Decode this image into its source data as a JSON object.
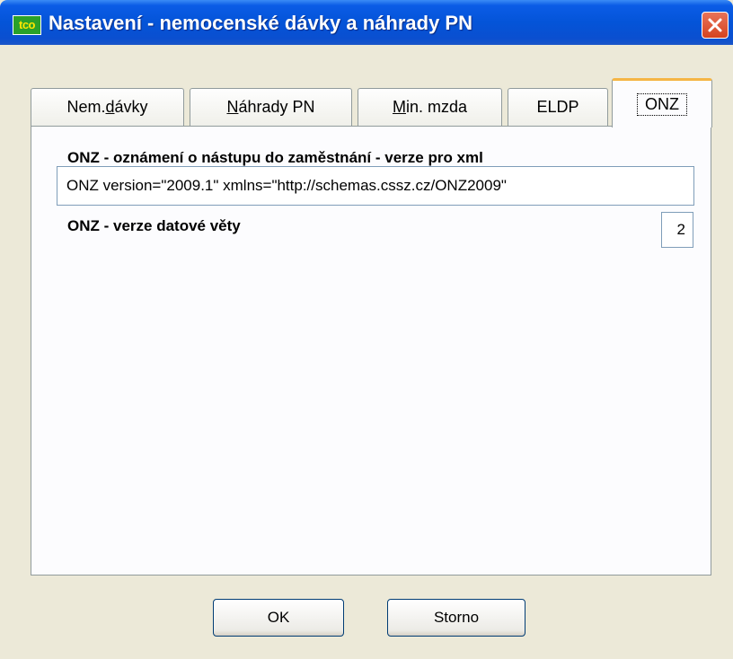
{
  "window": {
    "title": "Nastavení - nemocenské dávky a náhrady PN",
    "icon_text": "tco",
    "close_icon": "close-icon"
  },
  "tabs": [
    {
      "pre": "Nem.",
      "key": "d",
      "post": "ávky",
      "active": false
    },
    {
      "pre": "",
      "key": "N",
      "post": "áhrady PN",
      "active": false
    },
    {
      "pre": "",
      "key": "M",
      "post": "in. mzda",
      "active": false
    },
    {
      "pre": "ELDP",
      "key": "",
      "post": "",
      "active": false
    },
    {
      "pre": "ONZ",
      "key": "",
      "post": "",
      "active": true
    }
  ],
  "onz": {
    "heading": "ONZ  - oznámení o nástupu do zaměstnání - verze pro xml",
    "xml_value": "ONZ version=\"2009.1\" xmlns=\"http://schemas.cssz.cz/ONZ2009\"",
    "version_label": "ONZ - verze datové věty",
    "version_value": "2"
  },
  "buttons": {
    "ok": "OK",
    "cancel": "Storno"
  },
  "colors": {
    "titlebar": "#0454d8",
    "dialog_bg": "#ece9d8",
    "panel_bg": "#fcfcfe",
    "active_tab_accent": "#f5b545"
  }
}
